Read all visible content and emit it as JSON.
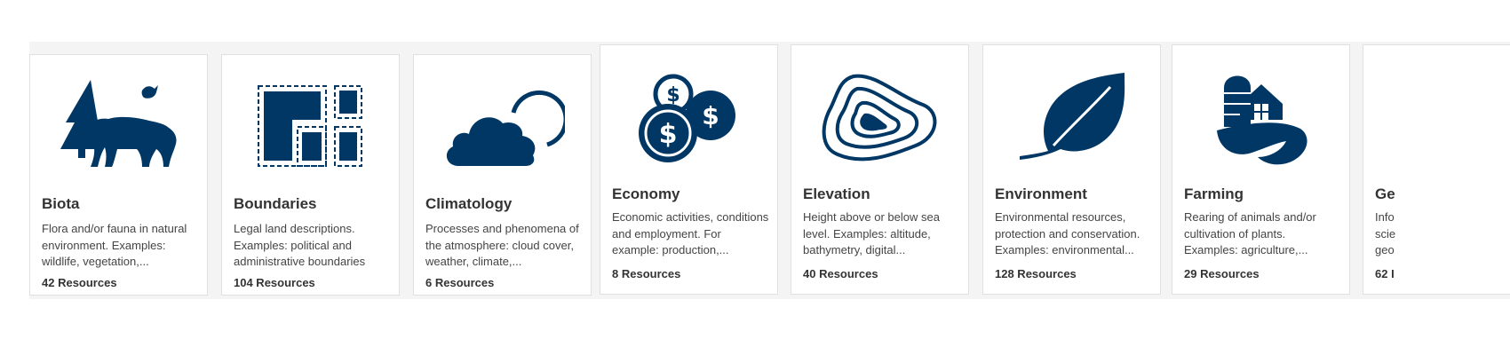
{
  "colors": {
    "icon": "#003764",
    "title": "#333333",
    "text": "#444444"
  },
  "categories": [
    {
      "title": "Biota",
      "icon": "bear-tree-bird-icon",
      "description": "Flora and/or fauna in natural environment. Examples: wildlife, vegetation,...",
      "count": "42 Resources"
    },
    {
      "title": "Boundaries",
      "icon": "boundary-blocks-icon",
      "description": "Legal land descriptions. Examples: political and administrative boundaries",
      "count": "104 Resources"
    },
    {
      "title": "Climatology",
      "icon": "cloud-sun-icon",
      "description": "Processes and phenomena of the atmosphere: cloud cover, weather, climate,...",
      "count": "6 Resources"
    },
    {
      "title": "Economy",
      "icon": "coins-icon",
      "description": "Economic activities, conditions and employment. For example: production,...",
      "count": "8 Resources"
    },
    {
      "title": "Elevation",
      "icon": "contour-lines-icon",
      "description": "Height above or below sea level. Examples: altitude, bathymetry, digital...",
      "count": "40 Resources"
    },
    {
      "title": "Environment",
      "icon": "leaf-icon",
      "description": "Environmental resources, protection and conservation. Examples: environmental...",
      "count": "128 Resources"
    },
    {
      "title": "Farming",
      "icon": "barn-silo-icon",
      "description": "Rearing of animals and/or cultivation of plants. Examples: agriculture,...",
      "count": "29 Resources"
    },
    {
      "title": "Ge",
      "icon": "globe-icon",
      "description": "Info scie geo",
      "count": "62 I"
    }
  ]
}
